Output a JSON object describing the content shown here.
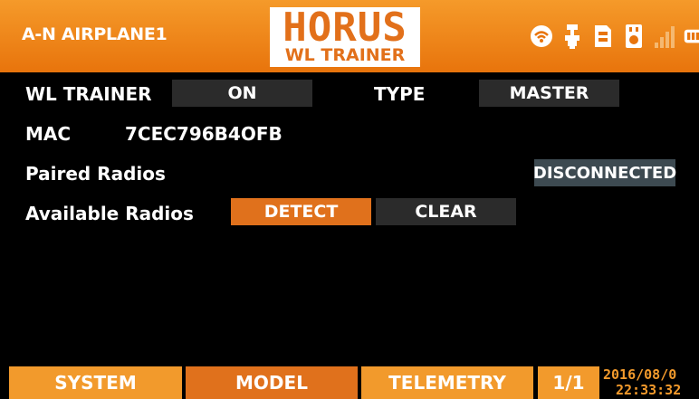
{
  "header": {
    "model_name": "A-N AIRPLANE1",
    "logo_title": "HORUS",
    "logo_subtitle": "WL TRAINER",
    "icons": [
      "wifi-icon",
      "trainer-icon",
      "sd-card-icon",
      "usb-icon",
      "signal-bars-icon",
      "battery-icon"
    ],
    "accent_color": "#f29a2c"
  },
  "settings": {
    "wl_trainer_label": "WL TRAINER",
    "wl_trainer_value": "ON",
    "type_label": "TYPE",
    "type_value": "MASTER",
    "mac_label": "MAC",
    "mac_value": "7CEC796B4OFB",
    "paired_label": "Paired Radios",
    "paired_status": "DISCONNECTED",
    "available_label": "Available Radios",
    "detect_label": "DETECT",
    "clear_label": "CLEAR"
  },
  "footer": {
    "tabs": [
      "SYSTEM",
      "MODEL",
      "TELEMETRY"
    ],
    "page": "1/1",
    "date": "2016/08/0",
    "time": "22:33:32"
  }
}
